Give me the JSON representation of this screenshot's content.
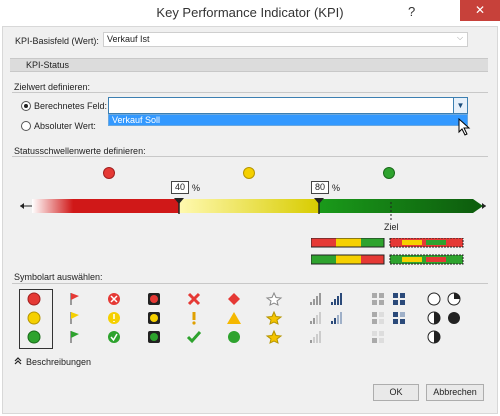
{
  "window": {
    "title": "Key Performance Indicator (KPI)",
    "help_label": "?",
    "close_label": "✕"
  },
  "base_field": {
    "label": "KPI-Basisfeld (Wert):",
    "value": "Verkauf Ist"
  },
  "kpi_status_tab": "KPI-Status",
  "target": {
    "heading": "Zielwert definieren:",
    "calculated_label": "Berechnetes Feld:",
    "absolute_label": "Absoluter Wert:",
    "calculated_selected": true,
    "dropdown_option": "Verkauf Soll"
  },
  "thresholds": {
    "heading": "Statusschwellenwerte definieren:",
    "low": "40",
    "high": "80",
    "unit": "%",
    "goal_label": "Ziel"
  },
  "symbols": {
    "heading": "Symbolart auswählen:"
  },
  "descriptions_label": "Beschreibungen",
  "buttons": {
    "ok": "OK",
    "cancel": "Abbrechen"
  },
  "colors": {
    "red": "#e53935",
    "yellow": "#f5d000",
    "green": "#2ea32e",
    "accent": "#3399ff"
  }
}
